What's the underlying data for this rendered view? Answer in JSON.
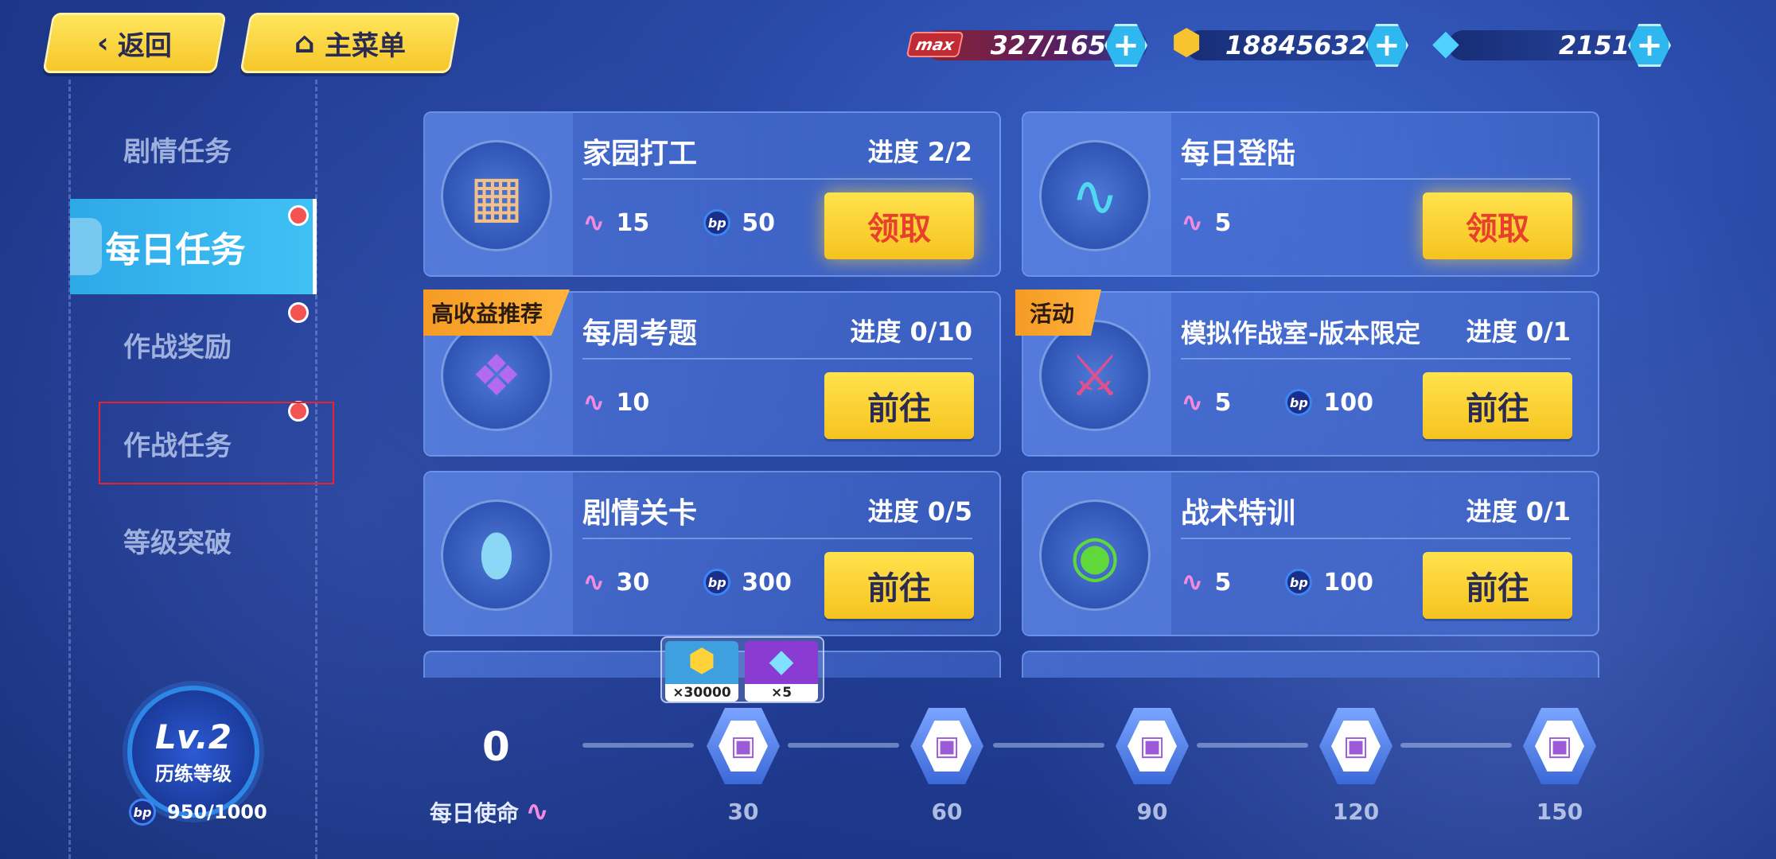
{
  "header": {
    "back_label": "返回",
    "menu_label": "主菜单",
    "stamina": {
      "max_tag": "max",
      "value": "327/165"
    },
    "gold": {
      "value": "18845632"
    },
    "gems": {
      "value": "2151"
    }
  },
  "sidebar": {
    "items": [
      {
        "label": "剧情任务",
        "active": false,
        "badge": false
      },
      {
        "label": "每日任务",
        "active": true,
        "badge": true
      },
      {
        "label": "作战奖励",
        "active": false,
        "badge": true
      },
      {
        "label": "作战任务",
        "active": false,
        "badge": true
      },
      {
        "label": "等级突破",
        "active": false,
        "badge": false
      }
    ]
  },
  "level": {
    "level_text": "Lv.2",
    "level_label": "历练等级",
    "bp_icon": "bp",
    "bp_value": "950/1000"
  },
  "tasks": [
    {
      "title": "家园打工",
      "progress": "进度 2/2",
      "activity": "15",
      "bp": "50",
      "action": "领取",
      "icon": "point-card-icon"
    },
    {
      "title": "每日登陆",
      "progress": "",
      "activity": "5",
      "bp": "",
      "action": "领取",
      "icon": "pulse-icon"
    },
    {
      "title": "每周考题",
      "progress": "进度 0/10",
      "activity": "10",
      "bp": "",
      "action": "前往",
      "tag": "高收益推荐",
      "icon": "crystal-icon"
    },
    {
      "title": "模拟作战室-版本限定",
      "progress": "进度 0/1",
      "activity": "5",
      "bp": "100",
      "action": "前往",
      "tag": "活动",
      "icon": "weapon-icon"
    },
    {
      "title": "剧情关卡",
      "progress": "进度 0/5",
      "activity": "30",
      "bp": "300",
      "action": "前往",
      "icon": "egg-icon"
    },
    {
      "title": "战术特训",
      "progress": "进度 0/1",
      "activity": "5",
      "bp": "100",
      "action": "前往",
      "icon": "disc-icon"
    }
  ],
  "mission": {
    "label": "每日使命",
    "current": "0",
    "milestones": [
      "30",
      "60",
      "90",
      "120",
      "150"
    ],
    "reward_popup": [
      {
        "icon": "gold-coin-icon",
        "qty": "×30000"
      },
      {
        "icon": "blue-crystal-icon",
        "qty": "×5"
      }
    ]
  },
  "colors": {
    "accent_yellow": "#f6c72a",
    "active_tab": "#3fc1f4",
    "badge_red": "#f45353",
    "claim_text": "#e8402c"
  }
}
